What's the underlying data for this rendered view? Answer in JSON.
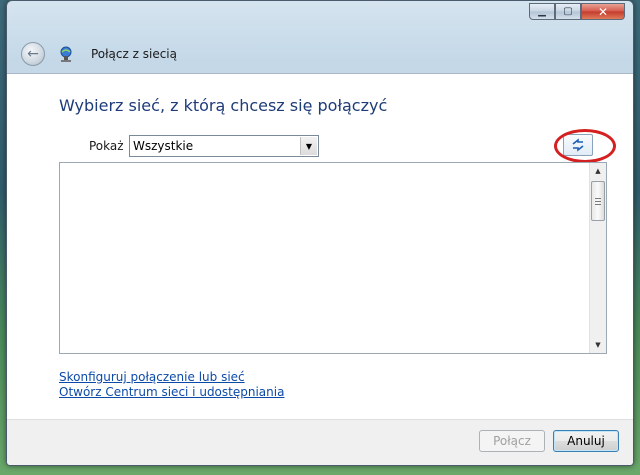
{
  "window": {
    "title": "Połącz z siecią",
    "caption_buttons": [
      "minimize",
      "maximize",
      "close"
    ]
  },
  "icons": {
    "back": "back-arrow-icon",
    "network": "network-icon",
    "refresh": "refresh-icon"
  },
  "main": {
    "heading": "Wybierz sieć, z którą chcesz się połączyć",
    "show_label": "Pokaż",
    "show_selected": "Wszystkie",
    "network_list": []
  },
  "links": {
    "configure": "Skonfiguruj połączenie lub sieć",
    "network_center": "Otwórz Centrum sieci i udostępniania"
  },
  "footer": {
    "connect_label": "Połącz",
    "cancel_label": "Anuluj"
  },
  "colors": {
    "heading": "#1e3c78",
    "link": "#0c4aa8",
    "highlight_ring": "#d42020"
  }
}
